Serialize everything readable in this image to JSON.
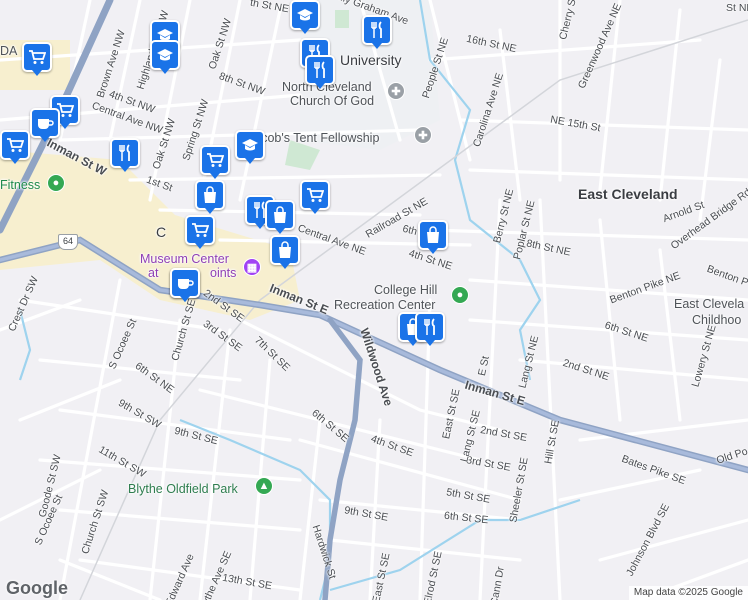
{
  "attribution": "Map data ©2025 Google",
  "logo": "Google",
  "places": {
    "east_cleveland": "East Cleveland",
    "east_cleveland_2": "East Clevela",
    "childhood": "Childhoo",
    "university": "Lee University",
    "university_short": "L",
    "university_rest": "University",
    "church": "North Cleveland Church Of God",
    "church_l1": "North Cleveland",
    "church_l2": "Church Of God",
    "fellowship": "Jacob's Tent Fellowship",
    "recreation_l1": "College Hill",
    "recreation_l2": "Recreation Center",
    "park": "Blythe Oldfield Park",
    "museum_l1": "Museum Center",
    "museum_l2": "at Five Points",
    "museum_l1_short": "Museum Center",
    "museum_l2_short": "at ",
    "museum_l2_end": "oints",
    "fitness": "Fitness",
    "city_c": "C",
    "da": "DA"
  },
  "roads": {
    "inman_main": "Inman St E",
    "inman_e": "Inman St E",
    "inman_w": "Inman St W",
    "wildwood": "Wildwood Ave",
    "central_ne": "Central Ave NE",
    "central_nw": "Central Ave NW",
    "railroad": "Railroad St NE",
    "carolina": "Carolina Ave NE",
    "peoples": "People St NE",
    "sixteenth": "16th St NE",
    "fifteenth": "NE 15th St",
    "eighth_ne": "8th St NE",
    "sixth_ne": "6th St NE",
    "sixth_ne2": "6th St NE",
    "fourth_ne": "4th St NE",
    "second_ne": "2nd St NE",
    "second_se": "2nd St SE",
    "third_se": "3rd St SE",
    "third_se2": "3rd St SE",
    "fourth_se": "4th St SE",
    "fifth_st": "5th St SE",
    "sixth_se": "6th St SE",
    "sixth_se2": "6th St SE",
    "seventh_st": "7th St SE",
    "ninth_se": "9th St SE",
    "ninth_se2": "9th St SE",
    "ninth_sw": "9th St SW",
    "eleventh": "11th St SW",
    "thirteenth": "13th St SE",
    "second_sw": "2nd St SE",
    "berry": "Berry St NE",
    "poplar": "Poplar St NE",
    "lang_ne": "Lang St NE",
    "lang_se": "Lang St SE",
    "east_st": "East St SE",
    "east_st2": "East St SE",
    "e_st": "E St",
    "hill": "Hill St SE",
    "sheeler": "Sheeler St SE",
    "bates": "Bates Pike SE",
    "johnson": "Johnson Blvd SE",
    "old_po": "Old Po",
    "benton": "Benton Pike NE",
    "benton2": "Benton P",
    "overhead": "Overhead Bridge Rd N",
    "arnold": "Arnold St",
    "lowery": "Lowery St NE",
    "cherry": "Cherry St",
    "greenwood": "Greenwood Ave NE",
    "brown": "Brown Ave NW",
    "highland": "Highland Ave NW",
    "oak": "Oak St NW",
    "oak2": "Oak St NW",
    "spring": "Spring St NW",
    "fourth_nw": "4th St NW",
    "eighth_nw": "8th St NW",
    "first": "1st St",
    "church_st": "Church St SE",
    "church_sw": "Church St SW",
    "s_ocoee": "S Ocoee St",
    "s_ocoee2": "S Ocoee St",
    "crest": "Crest Dr SW",
    "goode": "Goode St SW",
    "hardwick": "Hardwick St",
    "elrod": "Elrod St SE",
    "edward": "Edward Ave",
    "blythe": "Blythe Ave SE",
    "cann": "Cann Dr",
    "east_st_s": "East St SE",
    "billy": "Billy Graham Ave",
    "sixth_nw": "6th St NE",
    "eighth_top": "th St NE",
    "st_ne": "St NE",
    "nd_st_se": "2nd St SE"
  },
  "shields": {
    "us64": "64"
  },
  "pins": [
    {
      "icon": "cart"
    },
    {
      "icon": "graduation-cap"
    },
    {
      "icon": "graduation-cap"
    },
    {
      "icon": "restaurant"
    },
    {
      "icon": "restaurant"
    },
    {
      "icon": "restaurant"
    },
    {
      "icon": "cart"
    },
    {
      "icon": "coffee"
    },
    {
      "icon": "cart"
    },
    {
      "icon": "restaurant"
    },
    {
      "icon": "graduation-cap"
    },
    {
      "icon": "cart"
    },
    {
      "icon": "shopping-bag"
    },
    {
      "icon": "restaurant"
    },
    {
      "icon": "shopping-bag"
    },
    {
      "icon": "shopping-bag"
    },
    {
      "icon": "cart"
    },
    {
      "icon": "coffee"
    },
    {
      "icon": "shopping-bag"
    },
    {
      "icon": "shopping-bag"
    },
    {
      "icon": "restaurant"
    },
    {
      "icon": "coffee"
    },
    {
      "icon": "cart"
    },
    {
      "icon": "graduation-cap"
    }
  ],
  "colors": {
    "background": "#f1f0f4",
    "road": "#ffffff",
    "highway": "#8fa3c4",
    "water": "#9ed3ee",
    "pin": "#1a73e8",
    "park_poi": "#34a853",
    "church_poi": "#9aa0a6",
    "museum_poi": "#a142f4",
    "downtown": "#f7efcf"
  }
}
